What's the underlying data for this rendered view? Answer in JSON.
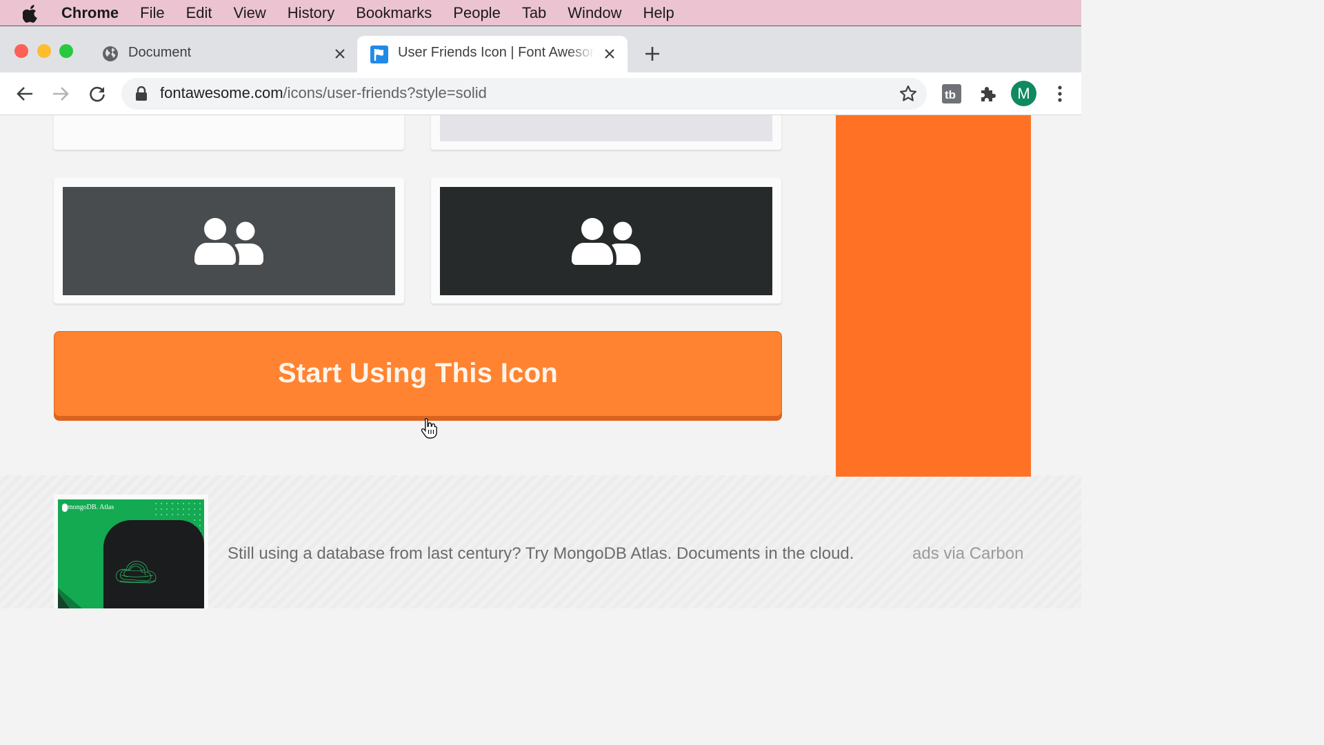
{
  "menubar": {
    "items": [
      "Chrome",
      "File",
      "Edit",
      "View",
      "History",
      "Bookmarks",
      "People",
      "Tab",
      "Window",
      "Help"
    ]
  },
  "tabs": [
    {
      "title": "Document",
      "icon": "globe-icon"
    },
    {
      "title": "User Friends Icon | Font Awesome",
      "icon": "font-awesome-flag-icon"
    }
  ],
  "toolbar": {
    "url_host": "fontawesome.com",
    "url_path": "/icons/user-friends?style=solid",
    "avatar_letter": "M"
  },
  "content": {
    "cta_label": "Start Using This Icon",
    "ad": {
      "brand": "mongoDB. Atlas",
      "text": "Still using a database from last century? Try MongoDB Atlas. Documents in the cloud.",
      "credit": "ads via Carbon"
    }
  },
  "colors": {
    "accent_orange": "#ff8330",
    "sidebar_orange": "#ff7225",
    "swatch_gray": "#484c4f",
    "swatch_dark": "#272a2b",
    "mongodb_green": "#13aa52"
  }
}
